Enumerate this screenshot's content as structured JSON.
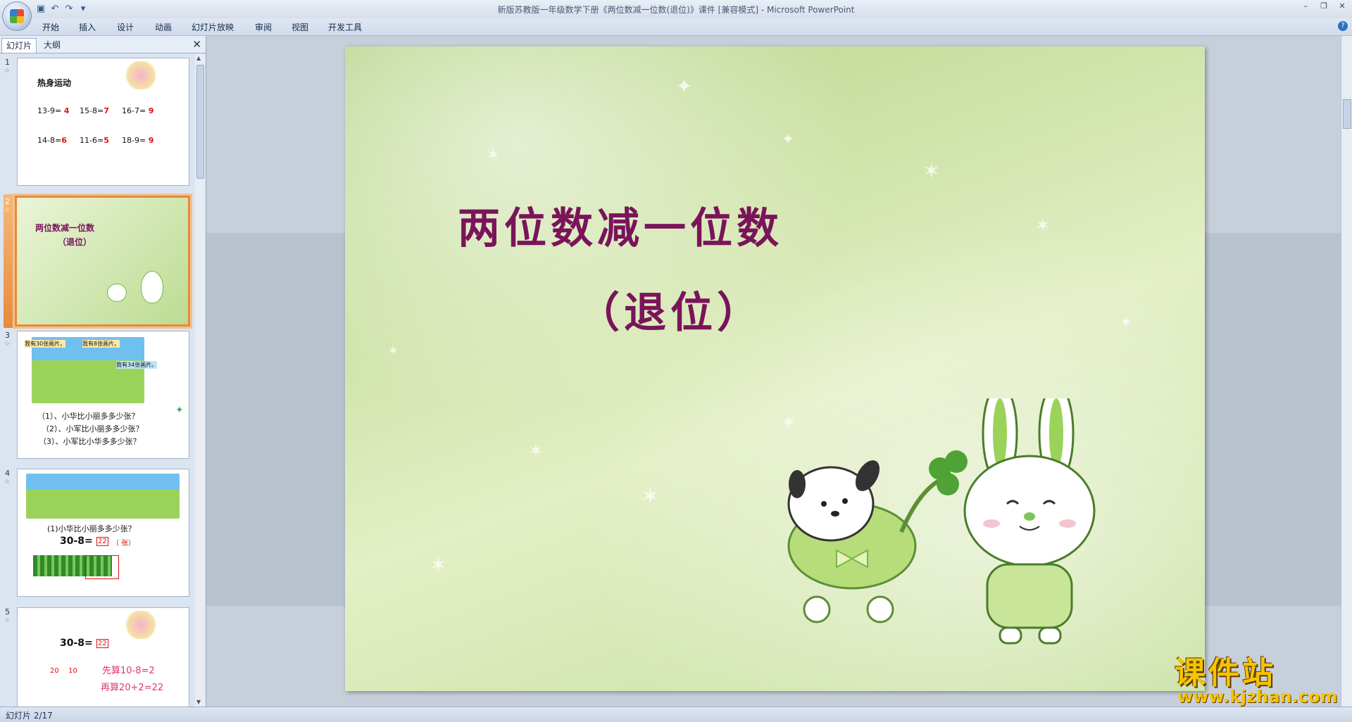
{
  "window": {
    "title": "新版苏教版一年级数学下册《两位数减一位数(退位)》课件 [兼容模式] - Microsoft PowerPoint"
  },
  "ribbon": {
    "tabs": [
      "开始",
      "插入",
      "设计",
      "动画",
      "幻灯片放映",
      "审阅",
      "视图",
      "开发工具"
    ]
  },
  "pane": {
    "tab_slides": "幻灯片",
    "tab_outline": "大纲"
  },
  "thumbnails": [
    {
      "number": "1",
      "title": "热身运动",
      "equations": [
        {
          "q": "13-9=",
          "a": "4"
        },
        {
          "q": "15-8=",
          "a": "7"
        },
        {
          "q": "16-7=",
          "a": "9"
        },
        {
          "q": "14-8=",
          "a": "6"
        },
        {
          "q": "11-6=",
          "a": "5"
        },
        {
          "q": "18-9=",
          "a": "9"
        }
      ]
    },
    {
      "number": "2",
      "line1": "两位数减一位数",
      "line2": "（退位）"
    },
    {
      "number": "3",
      "bubble1": "我有30张画片。",
      "bubble2": "我有8张画片。",
      "bubble3": "我有34张画片。",
      "questions": [
        "（1）、小华比小丽多多少张？",
        "（2）、小军比小丽多多少张？",
        "（3）、小军比小华多多少张？"
      ]
    },
    {
      "number": "4",
      "question": "(1)小华比小丽多多少张？",
      "equation": "30-8=",
      "answer": "22",
      "unit": "（  张）"
    },
    {
      "number": "5",
      "equation": "30-8=",
      "answer": "22",
      "split_a": "20",
      "split_b": "10",
      "step1": "先算10-8=2",
      "step2": "再算20+2=22"
    }
  ],
  "slide": {
    "title": "两位数减一位数",
    "subtitle": "（退位）"
  },
  "status": {
    "text": "幻灯片 2/17"
  },
  "watermark": {
    "big": "课件站",
    "small": "www.kjzhan.com"
  }
}
